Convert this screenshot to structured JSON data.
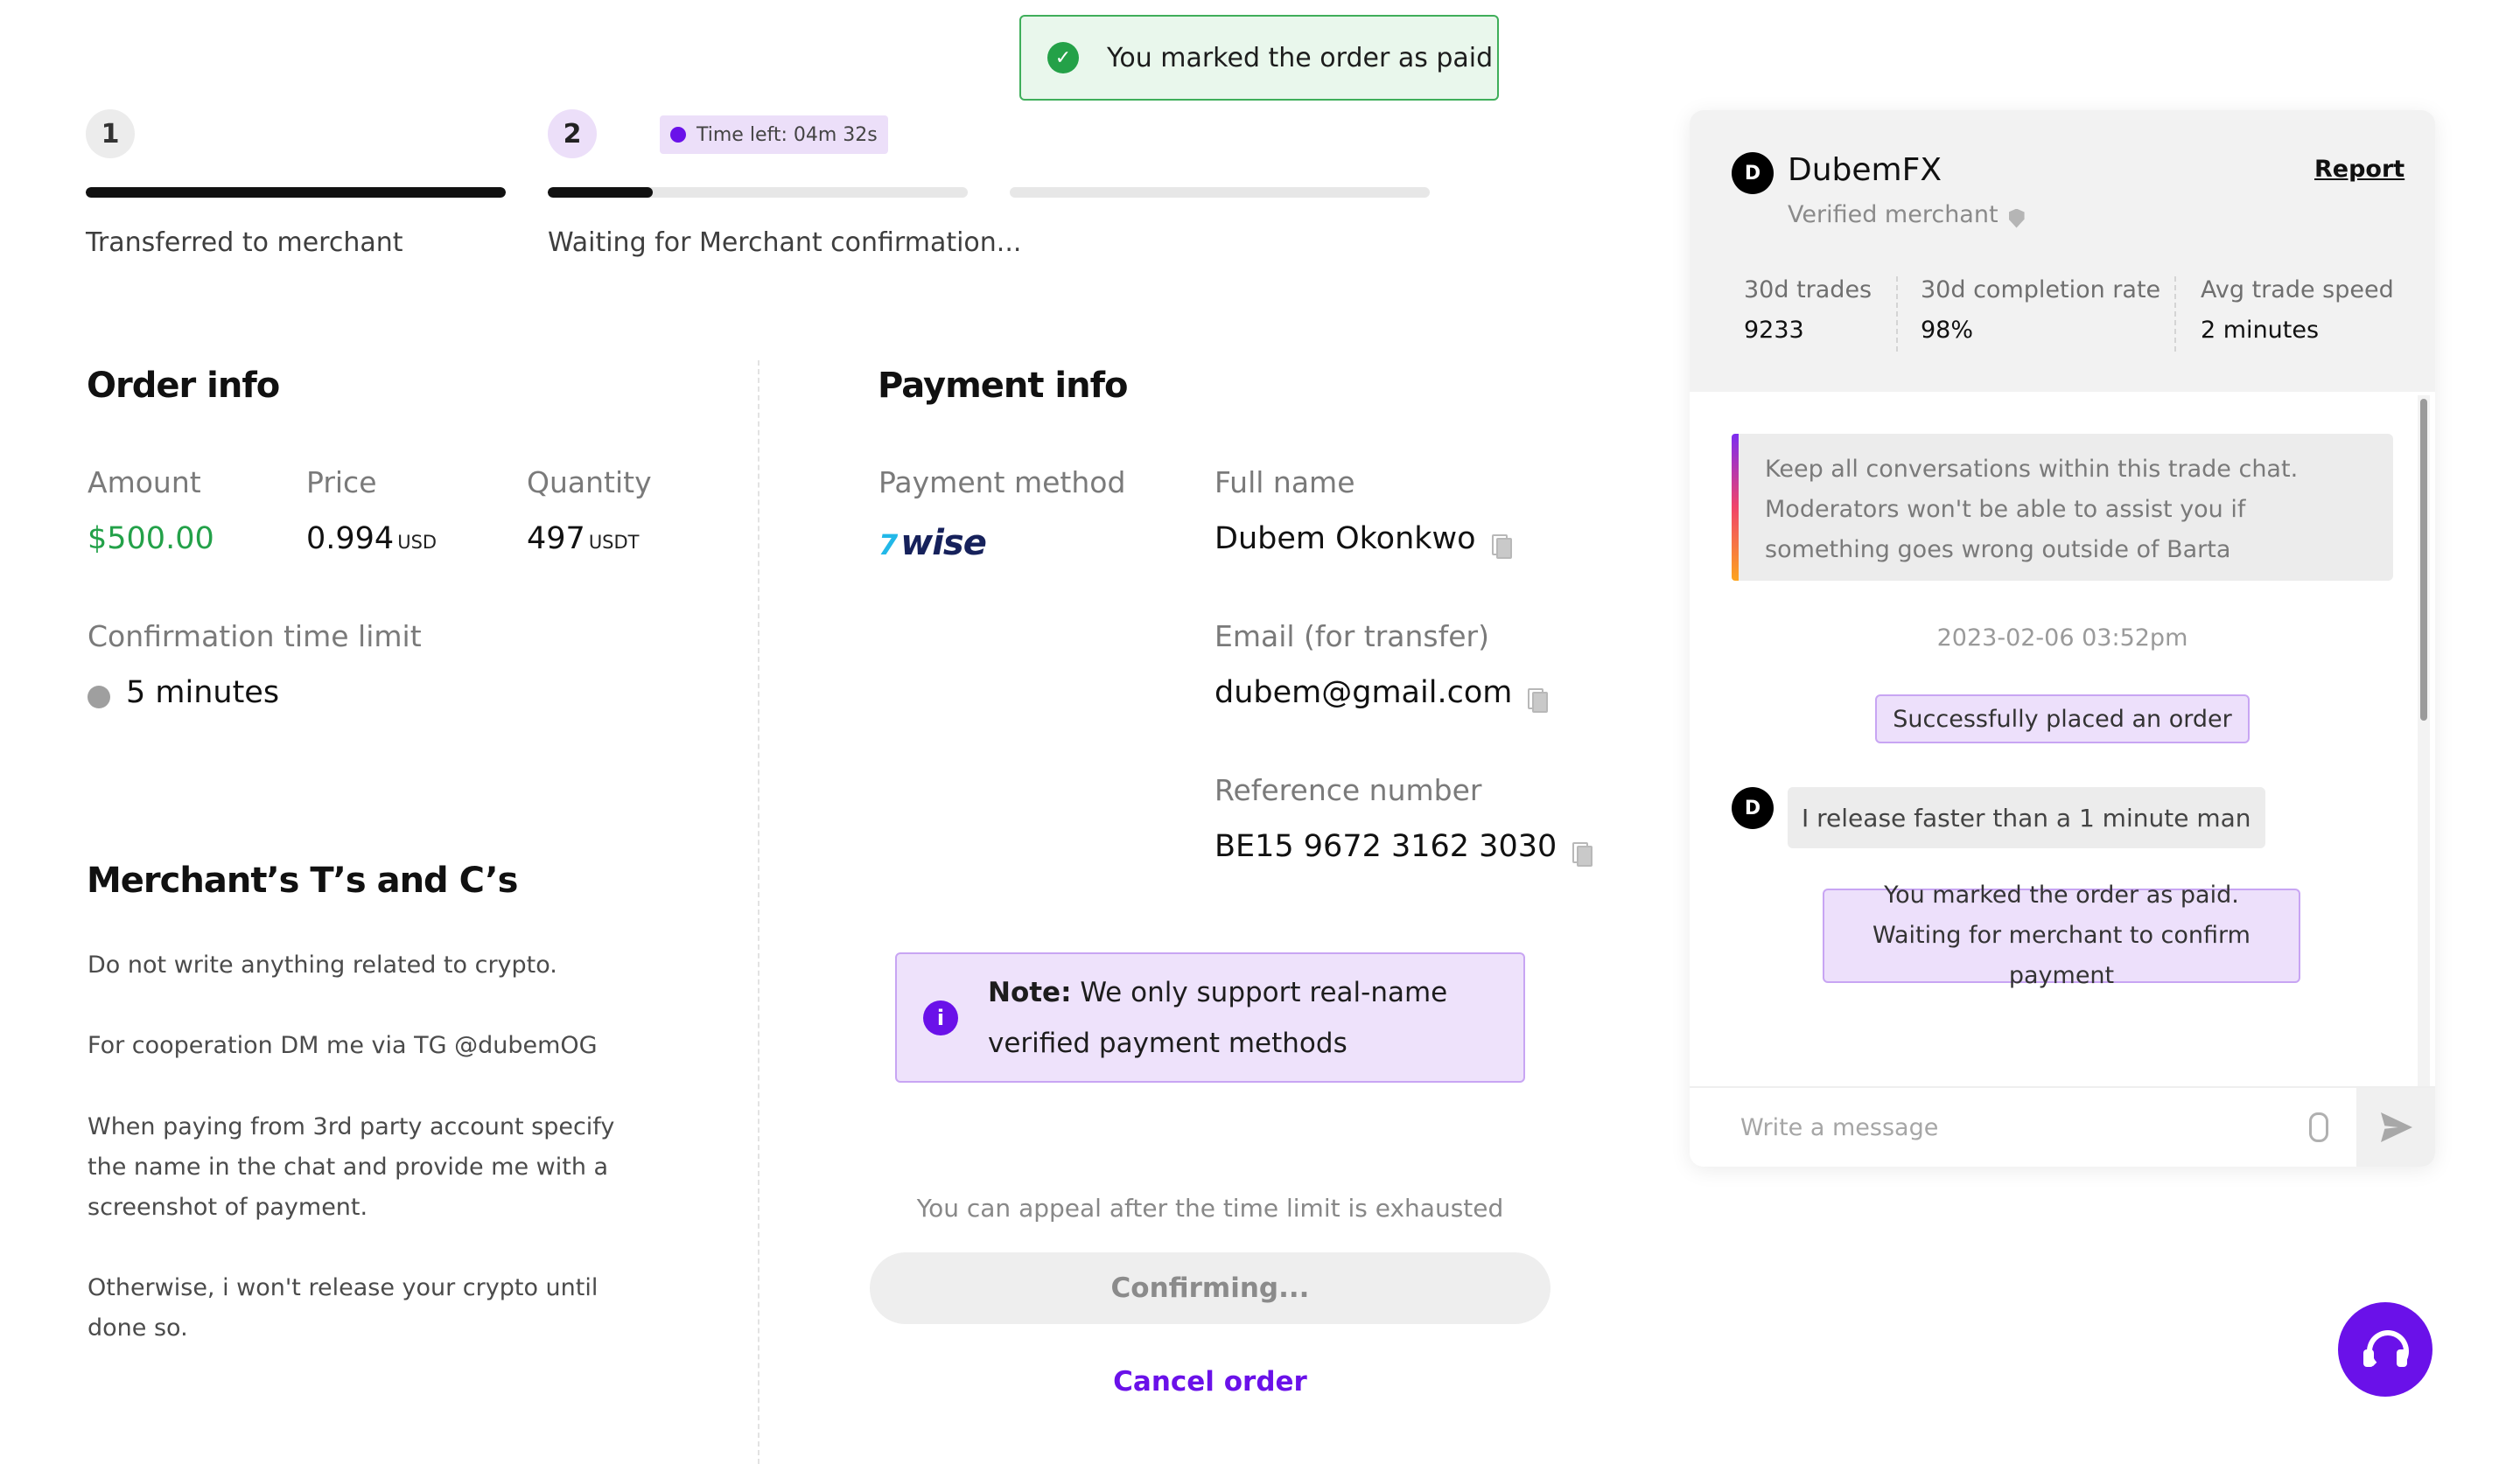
{
  "toast": {
    "message": "You marked the order as paid"
  },
  "progress": {
    "steps": [
      {
        "number": "1",
        "label": "Transferred to merchant",
        "fill": 1.0
      },
      {
        "number": "2",
        "label": "Waiting for Merchant confirmation...",
        "fill": 0.25
      },
      {
        "number": "",
        "label": "",
        "fill": 0.0
      }
    ],
    "timer": "Time left: 04m 32s"
  },
  "order_info": {
    "heading": "Order info",
    "amount_label": "Amount",
    "amount_value": "$500.00",
    "price_label": "Price",
    "price_value": "0.994",
    "price_unit": "USD",
    "quantity_label": "Quantity",
    "quantity_value": "497",
    "quantity_unit": "USDT",
    "time_limit_label": "Confirmation time limit",
    "time_limit_value": "5 minutes"
  },
  "terms": {
    "heading": "Merchant’s T’s and C’s",
    "paragraphs": [
      "Do not write anything related to crypto.",
      "For cooperation DM me via TG @dubemOG",
      "When paying from 3rd party account specify the name in the chat and provide me with a screenshot of payment.",
      "Otherwise, i won't release your crypto until done so."
    ]
  },
  "payment_info": {
    "heading": "Payment info",
    "method_label": "Payment method",
    "method_logo_flag": "7",
    "method_logo_text": "wise",
    "full_name_label": "Full name",
    "full_name_value": "Dubem Okonkwo",
    "email_label": "Email (for transfer)",
    "email_value": "dubem@gmail.com",
    "reference_label": "Reference number",
    "reference_value": "BE15 9672 3162 3030"
  },
  "note": {
    "prefix": "Note:",
    "text": "We only support real-name verified payment methods"
  },
  "actions": {
    "appeal_text": "You can appeal after the time limit is exhausted",
    "confirm_label": "Confirming...",
    "cancel_label": "Cancel order"
  },
  "chat": {
    "merchant_initial": "D",
    "merchant_name": "DubemFX",
    "verified_label": "Verified merchant",
    "report_label": "Report",
    "stats": [
      {
        "label": "30d trades",
        "value": "9233"
      },
      {
        "label": "30d completion rate",
        "value": "98%"
      },
      {
        "label": "Avg trade speed",
        "value": "2 minutes"
      }
    ],
    "system_message": "Keep all conversations within this trade chat. Moderators won't be able to assist you if something goes wrong outside of Barta",
    "timestamp": "2023-02-06 03:52pm",
    "order_placed": "Successfully placed an order",
    "merchant_message": "I release faster than a 1 minute man",
    "paid_message": "You marked the order as paid. Waiting for merchant to confirm payment",
    "input_placeholder": "Write a message"
  },
  "colors": {
    "accent": "#6a11e9",
    "success": "#23a149",
    "note_bg": "#eee2fb"
  },
  "icons": [
    "check-icon",
    "timer-icon",
    "copy-icon",
    "info-icon",
    "stopwatch-icon",
    "shield-icon",
    "paperclip-icon",
    "send-icon",
    "headset-icon"
  ]
}
